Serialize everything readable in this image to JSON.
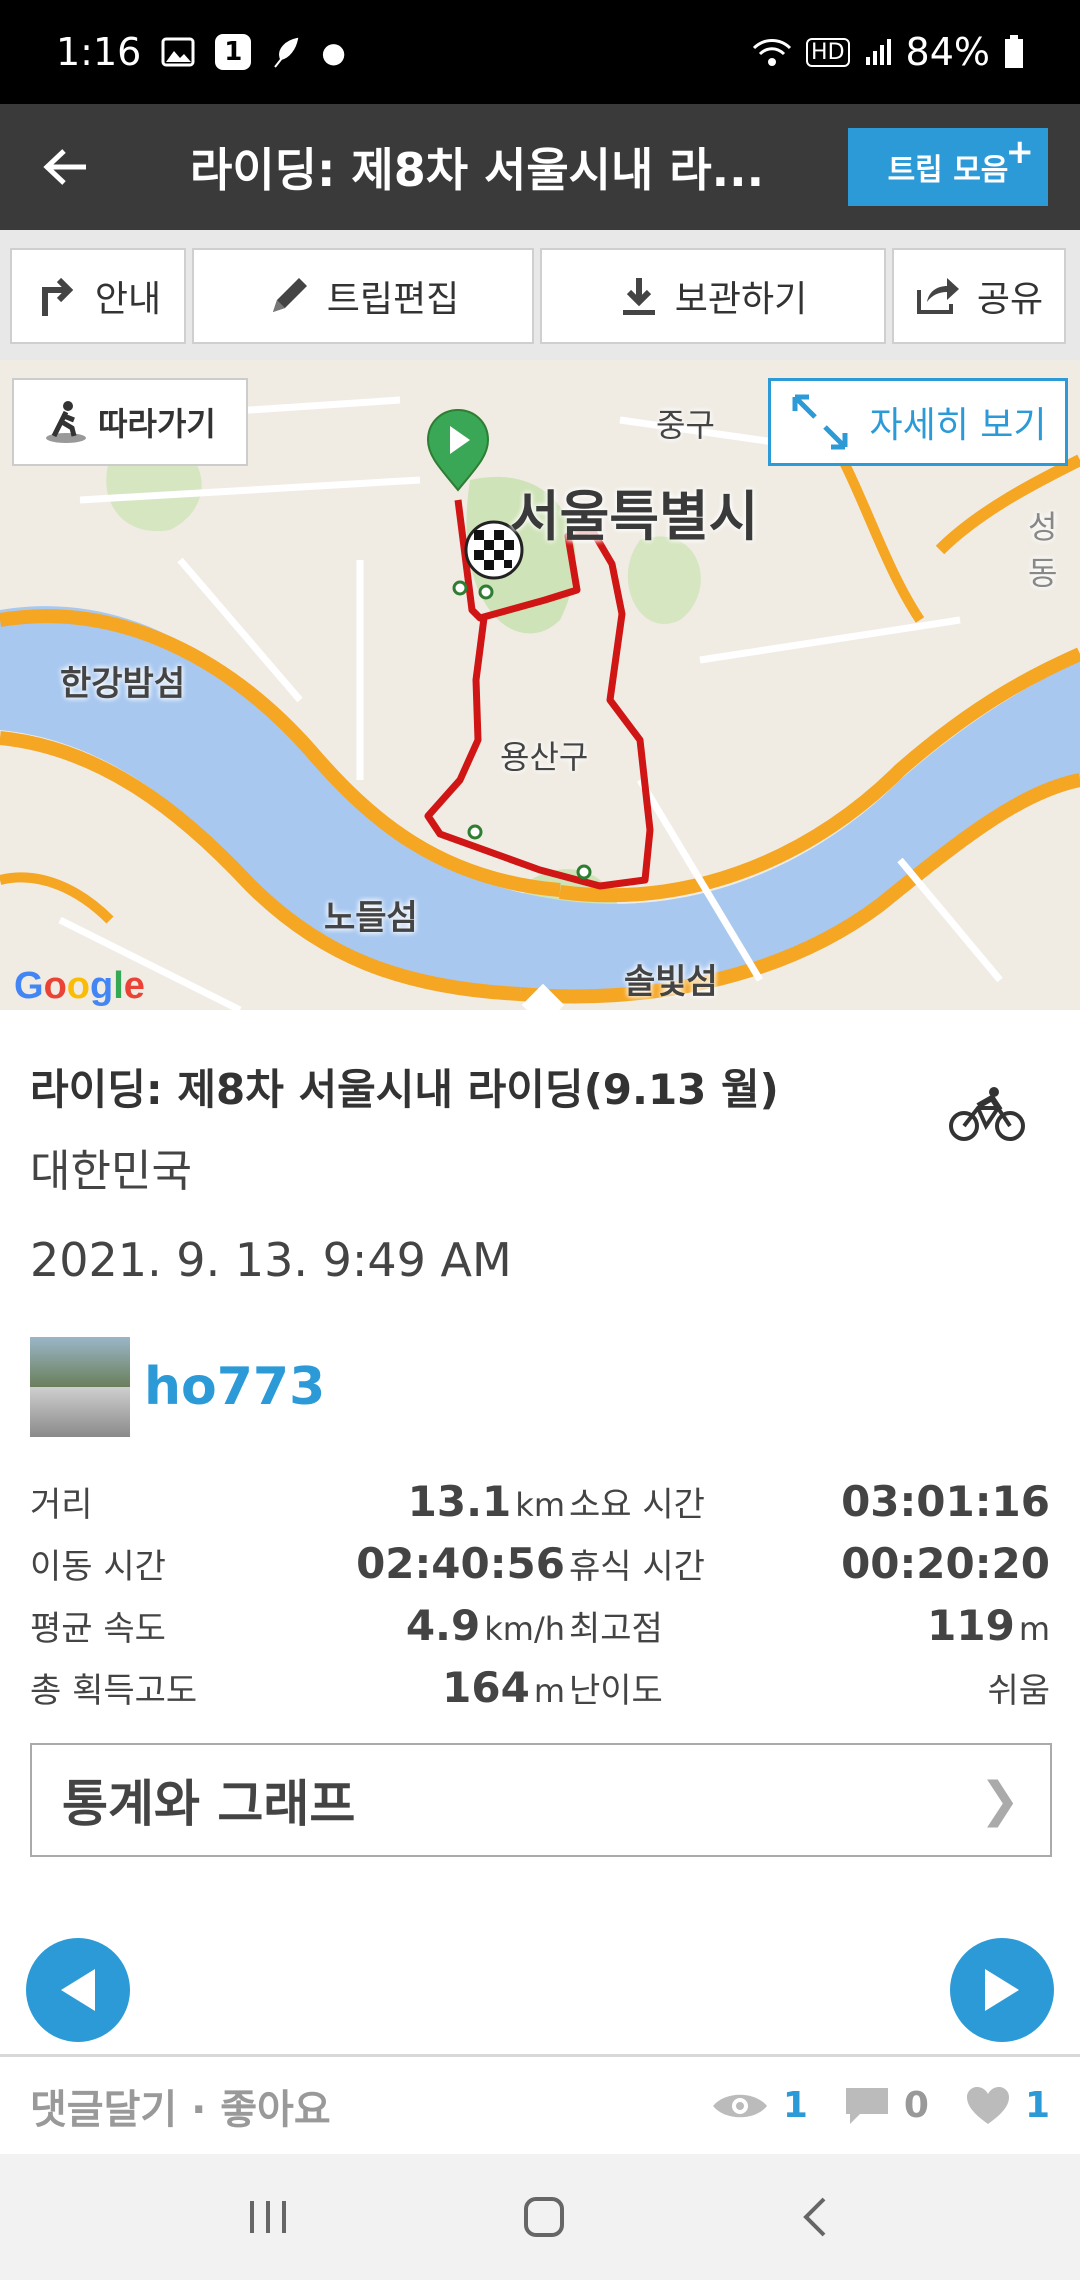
{
  "status_bar": {
    "time": "1:16",
    "badge": "1",
    "battery": "84%"
  },
  "app_bar": {
    "title": "라이딩: 제8차 서울시내 라...",
    "trip_button": "트립 모음",
    "trip_button_plus": "+"
  },
  "toolbar": {
    "guide": "안내",
    "edit": "트립편집",
    "save": "보관하기",
    "share": "공유"
  },
  "map": {
    "follow_label": "따라가기",
    "detail_label": "자세히 보기",
    "labels": {
      "seoul": "서울특별시",
      "junggu": "중구",
      "hangang_island": "한강밤섬",
      "yongsan": "용산구",
      "nodeulseom": "노들섬",
      "solbitseom": "솔빛섬",
      "seongdong": "성동"
    },
    "google_letters": [
      "G",
      "o",
      "o",
      "g",
      "l",
      "e"
    ]
  },
  "trip": {
    "title": "라이딩: 제8차 서울시내 라이딩(9.13  월)",
    "country": "대한민국",
    "datetime": "2021. 9. 13. 9:49 AM",
    "username": "ho773"
  },
  "stats": {
    "distance_label": "거리",
    "distance_value": "13.1",
    "distance_unit": "km",
    "duration_label": "소요 시간",
    "duration_value": "03:01:16",
    "moving_label": "이동 시간",
    "moving_value": "02:40:56",
    "rest_label": "휴식 시간",
    "rest_value": "00:20:20",
    "avg_speed_label": "평균 속도",
    "avg_speed_value": "4.9",
    "avg_speed_unit": "km/h",
    "max_elev_label": "최고점",
    "max_elev_value": "119",
    "max_elev_unit": "m",
    "gain_label": "총 획득고도",
    "gain_value": "164",
    "gain_unit": "m",
    "difficulty_label": "난이도",
    "difficulty_value": "쉬움"
  },
  "graph_button": {
    "label": "통계와 그래프",
    "chevron": "❯"
  },
  "footer": {
    "link": "댓글달기 · 좋아요",
    "views": "1",
    "comments": "0",
    "likes": "1"
  },
  "colors": {
    "accent": "#2d9ad8",
    "route": "#d01515",
    "water": "#a8c8f0",
    "road": "#f5a623"
  }
}
